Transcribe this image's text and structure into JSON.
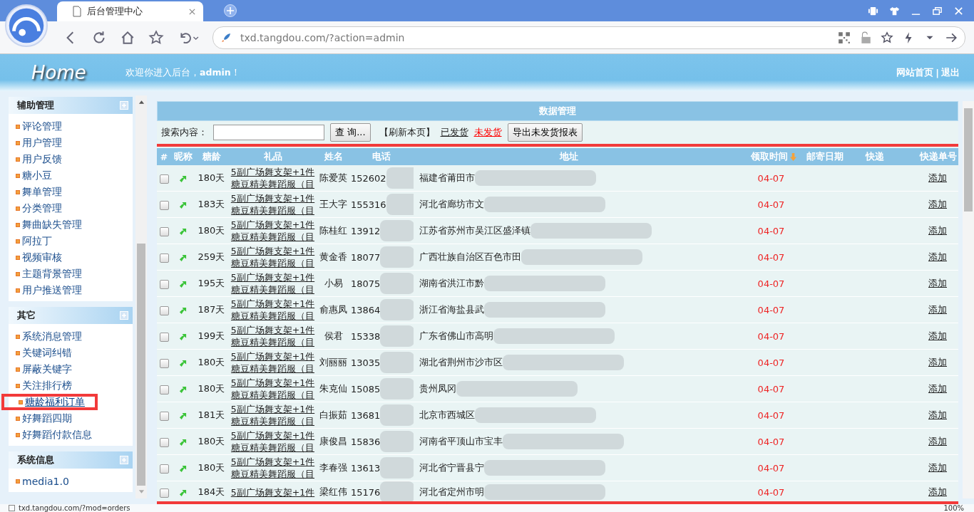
{
  "browser": {
    "tab_title": "后台管理中心",
    "url": "txd.tangdou.com/?action=admin"
  },
  "header": {
    "logo": "Home",
    "welcome": "欢迎你进入后台，**admin**！",
    "links": [
      "网站首页",
      "退出"
    ],
    "separator": "|"
  },
  "sidebar": {
    "sections": [
      {
        "title": "辅助管理",
        "items": [
          {
            "label": "评论管理",
            "selected": false
          },
          {
            "label": "用户管理",
            "selected": false
          },
          {
            "label": "用户反馈",
            "selected": false
          },
          {
            "label": "糖小豆",
            "selected": false
          },
          {
            "label": "舞单管理",
            "selected": false
          },
          {
            "label": "分类管理",
            "selected": false
          },
          {
            "label": "舞曲缺失管理",
            "selected": false
          },
          {
            "label": "阿拉丁",
            "selected": false
          },
          {
            "label": "视频审核",
            "selected": false
          },
          {
            "label": "主题背景管理",
            "selected": false
          },
          {
            "label": "用户推送管理",
            "selected": false
          }
        ]
      },
      {
        "title": "其它",
        "items": [
          {
            "label": "系统消息管理",
            "selected": false
          },
          {
            "label": "关键词纠错",
            "selected": false
          },
          {
            "label": "屏蔽关键字",
            "selected": false
          },
          {
            "label": "关注排行榜",
            "selected": false
          },
          {
            "label": "糖龄福利订单",
            "selected": true
          },
          {
            "label": "好舞蹈四期",
            "selected": false
          },
          {
            "label": "好舞蹈付款信息",
            "selected": false
          }
        ]
      },
      {
        "title": "系统信息",
        "items": [
          {
            "label": "media1.0",
            "selected": false
          }
        ]
      }
    ]
  },
  "panel": {
    "title": "数据管理",
    "search_label": "搜索内容：",
    "search_button": "查 询...",
    "refresh_link": "【刷新本页】",
    "filters": [
      {
        "label": "已发货",
        "selected": false
      },
      {
        "label": "未发货",
        "selected": true
      }
    ],
    "export_button": "导出未发货报表"
  },
  "table": {
    "columns": [
      {
        "label": "#",
        "sorted": false
      },
      {
        "label": "昵称",
        "sorted": false
      },
      {
        "label": "糖龄",
        "sorted": false
      },
      {
        "label": "礼品",
        "sorted": false
      },
      {
        "label": "姓名",
        "sorted": false
      },
      {
        "label": "电话",
        "sorted": false
      },
      {
        "label": "地址",
        "sorted": false
      },
      {
        "label": "领取时间",
        "sorted": true
      },
      {
        "label": "邮寄日期",
        "sorted": false
      },
      {
        "label": "快递",
        "sorted": false
      },
      {
        "label": "快递单号",
        "sorted": false
      }
    ],
    "rows": [
      {
        "checked": false,
        "age": "180天",
        "gift": [
          "5副广场舞支架+1件",
          "糖豆精美舞蹈服（目"
        ],
        "name": "陈爱英",
        "phone": "152602",
        "address": "福建省莆田市",
        "claim_date": "04-07",
        "action": "添加"
      },
      {
        "checked": false,
        "age": "183天",
        "gift": [
          "5副广场舞支架+1件",
          "糖豆精美舞蹈服（目"
        ],
        "name": "王大字",
        "phone": "155316",
        "address": "河北省廊坊市文",
        "claim_date": "04-07",
        "action": "添加"
      },
      {
        "checked": false,
        "age": "180天",
        "gift": [
          "5副广场舞支架+1件",
          "糖豆精美舞蹈服（目"
        ],
        "name": "陈桂红",
        "phone": "13912",
        "address": "江苏省苏州市吴江区盛泽镇",
        "claim_date": "04-07",
        "action": "添加"
      },
      {
        "checked": false,
        "age": "259天",
        "gift": [
          "5副广场舞支架+1件",
          "糖豆精美舞蹈服（目"
        ],
        "name": "黄金香",
        "phone": "18077",
        "address": "广西壮族自治区百色市田",
        "claim_date": "04-07",
        "action": "添加"
      },
      {
        "checked": false,
        "age": "195天",
        "gift": [
          "5副广场舞支架+1件",
          "糖豆精美舞蹈服（目"
        ],
        "name": "小易",
        "phone": "18075",
        "address": "湖南省洪江市黔",
        "claim_date": "04-07",
        "action": "添加"
      },
      {
        "checked": false,
        "age": "187天",
        "gift": [
          "5副广场舞支架+1件",
          "糖豆精美舞蹈服（目"
        ],
        "name": "俞惠凤",
        "phone": "13864",
        "address": "浙江省海盐县武",
        "claim_date": "04-07",
        "action": "添加"
      },
      {
        "checked": false,
        "age": "199天",
        "gift": [
          "5副广场舞支架+1件",
          "糖豆精美舞蹈服（目"
        ],
        "name": "侯君",
        "phone": "15338",
        "address": "广东省佛山市高明",
        "claim_date": "04-07",
        "action": "添加"
      },
      {
        "checked": false,
        "age": "180天",
        "gift": [
          "5副广场舞支架+1件",
          "糖豆精美舞蹈服（目"
        ],
        "name": "刘丽丽",
        "phone": "13035",
        "address": "湖北省荆州市沙市区",
        "claim_date": "04-07",
        "action": "添加"
      },
      {
        "checked": false,
        "age": "180天",
        "gift": [
          "5副广场舞支架+1件",
          "糖豆精美舞蹈服（目"
        ],
        "name": "朱克仙",
        "phone": "15085",
        "address": "贵州凤冈",
        "claim_date": "04-07",
        "action": "添加"
      },
      {
        "checked": false,
        "age": "181天",
        "gift": [
          "5副广场舞支架+1件",
          "糖豆精美舞蹈服（目"
        ],
        "name": "白振茹",
        "phone": "13681",
        "address": "北京市西城区",
        "claim_date": "04-07",
        "action": "添加"
      },
      {
        "checked": false,
        "age": "180天",
        "gift": [
          "5副广场舞支架+1件",
          "糖豆精美舞蹈服（目"
        ],
        "name": "康俊昌",
        "phone": "15836",
        "address": "河南省平顶山市宝丰",
        "claim_date": "04-07",
        "action": "添加"
      },
      {
        "checked": false,
        "age": "180天",
        "gift": [
          "5副广场舞支架+1件",
          "糖豆精美舞蹈服（目"
        ],
        "name": "李春强",
        "phone": "13613",
        "address": "河北省宁晋县宁",
        "claim_date": "04-07",
        "action": "添加"
      },
      {
        "checked": false,
        "age": "184天",
        "gift": [
          "5副广场舞支架+1件"
        ],
        "name": "梁红伟",
        "phone": "15176",
        "address": "河北省定州市明",
        "claim_date": "04-07",
        "action": "添加"
      }
    ]
  },
  "status_bar": {
    "url": "txd.tangdou.com/?mod=orders",
    "zoom": "100%"
  }
}
